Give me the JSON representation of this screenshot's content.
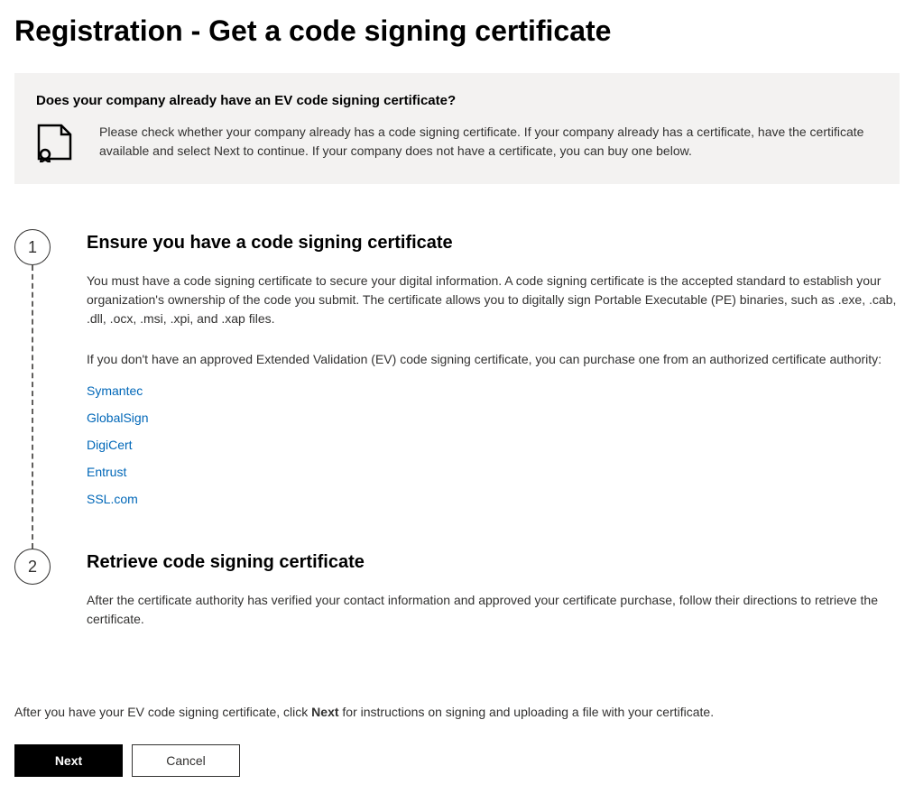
{
  "page_title": "Registration - Get a code signing certificate",
  "notice": {
    "heading": "Does your company already have an EV code signing certificate?",
    "body": "Please check whether your company already has a code signing certificate. If your company already has a certificate, have the certificate available and select Next to continue. If your company does not have a certificate, you can buy one below."
  },
  "steps": [
    {
      "number": "1",
      "heading": "Ensure you have a code signing certificate",
      "para1": "You must have a code signing certificate to secure your digital information. A code signing certificate is the accepted standard to establish your organization's ownership of the code you submit. The certificate allows you to digitally sign Portable Executable (PE) binaries, such as .exe, .cab, .dll, .ocx, .msi, .xpi, and .xap files.",
      "para2": "If you don't have an approved Extended Validation (EV) code signing certificate, you can purchase one from an authorized certificate authority:",
      "links": [
        "Symantec",
        "GlobalSign",
        "DigiCert",
        "Entrust",
        "SSL.com"
      ]
    },
    {
      "number": "2",
      "heading": "Retrieve code signing certificate",
      "para1": "After the certificate authority has verified your contact information and approved your certificate purchase, follow their directions to retrieve the certificate."
    }
  ],
  "footer": {
    "prefix": "After you have your EV code signing certificate, click ",
    "bold": "Next",
    "suffix": " for instructions on signing and uploading a file with your certificate."
  },
  "buttons": {
    "next": "Next",
    "cancel": "Cancel"
  }
}
